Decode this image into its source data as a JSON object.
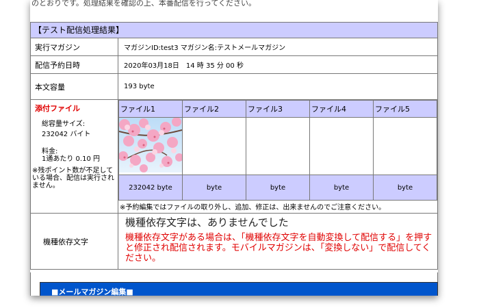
{
  "top_note": "のとおりです。処理結果を確認の上、本番配信を行ってください。",
  "section_title": "【テスト配信処理結果】",
  "rows": {
    "magazine": {
      "label": "実行マガジン",
      "value": "マガジンID:test3 マガジン名:テストメールマガジン"
    },
    "schedule": {
      "label": "配信予約日時",
      "value": "2020年03月18日　14 時 35 分 00 秒"
    },
    "body_size": {
      "label": "本文容量",
      "value": "193 byte"
    }
  },
  "attachments": {
    "title": "添付ファイル",
    "total_size_label": "総容量サイズ:",
    "total_size_value": "232042 バイト",
    "fee_label": "料金:",
    "fee_value": "1通あたり 0.10 円",
    "warning": "※残ポイント数が不足している場合、配信は実行されません。",
    "files": [
      {
        "header": "ファイル1",
        "size": "232042 byte",
        "has_image": true
      },
      {
        "header": "ファイル2",
        "size": "byte",
        "has_image": false
      },
      {
        "header": "ファイル3",
        "size": "byte",
        "has_image": false
      },
      {
        "header": "ファイル4",
        "size": "byte",
        "has_image": false
      },
      {
        "header": "ファイル5",
        "size": "byte",
        "has_image": false
      }
    ],
    "note": "※予約編集ではファイルの取り外し、追加、修正は、出来ませんのでご注意ください。"
  },
  "dependent_chars": {
    "label": "機種依存文字",
    "message": "機種依存文字は、ありませんでした",
    "warning": "機種依存文字がある場合は、「機種依存文字を自動変換して配信する」を押すと修正され配信されます。モバイルマガジンは、「変換しない」で配信してください。"
  },
  "edit_section": {
    "title": "■メールマガジン編集■"
  },
  "colors": {
    "header_bg": "#ccccff",
    "warning": "#e00000",
    "edit_bar": "#0055cc"
  }
}
